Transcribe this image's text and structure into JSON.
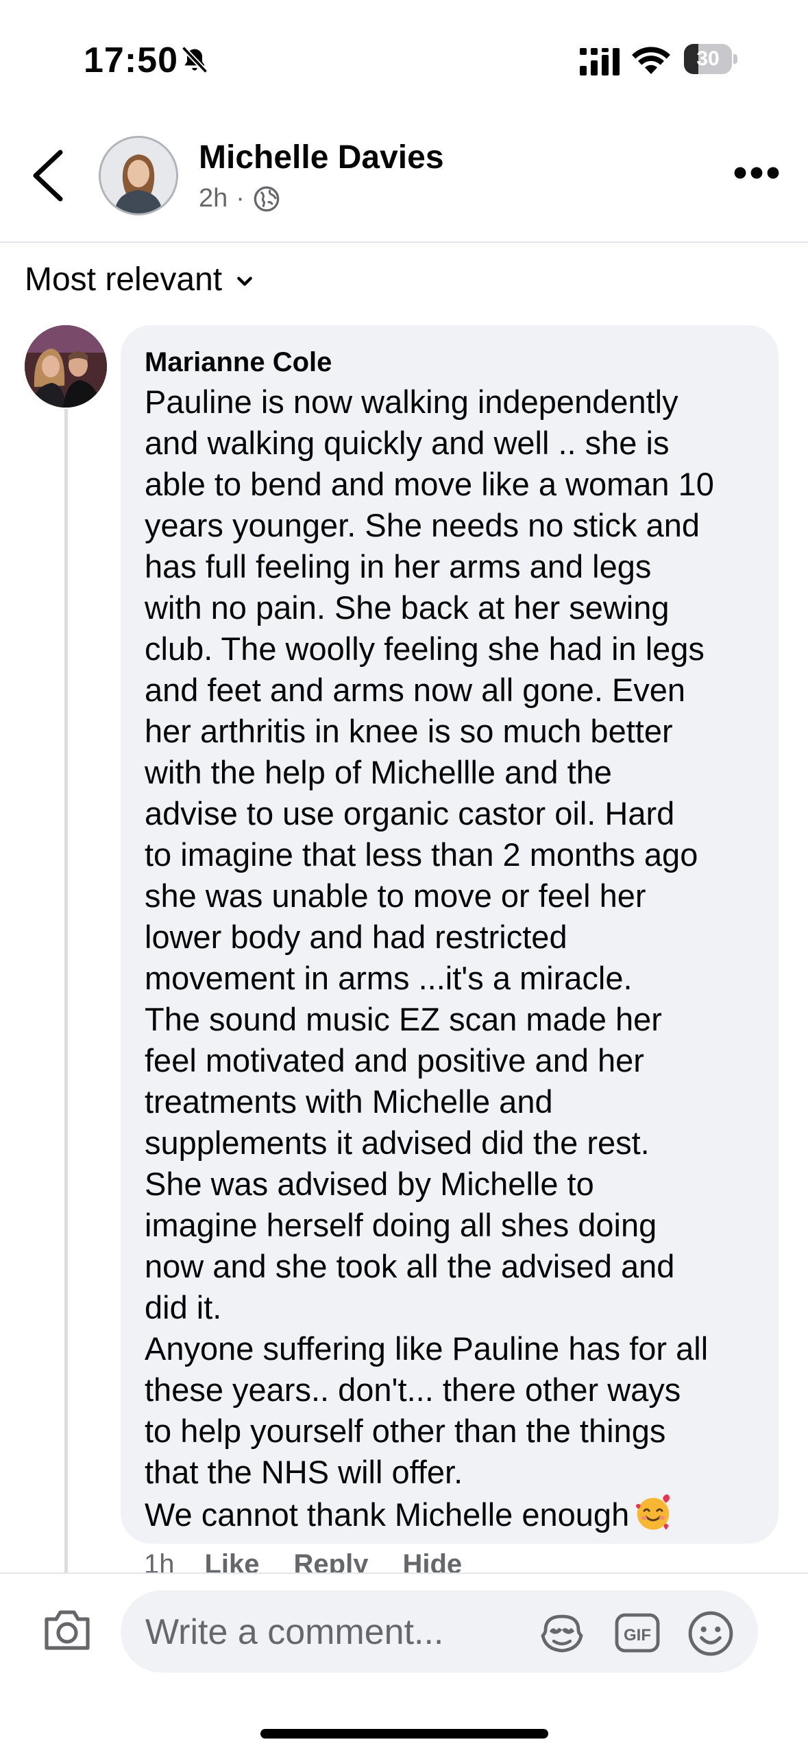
{
  "status_bar": {
    "time": "17:50",
    "battery": "30",
    "battery_level": 0.3,
    "icons": [
      "bell-slash-icon",
      "signal-icon",
      "wifi-icon",
      "battery-icon"
    ]
  },
  "header": {
    "name": "Michelle Davies",
    "age": "2h",
    "separator": "·",
    "audience_icon": "globe-icon",
    "back_icon": "chevron-left-icon",
    "more_icon": "more-horizontal-icon"
  },
  "sort": {
    "label": "Most relevant",
    "icon": "chevron-down-icon"
  },
  "comment": {
    "author": "Marianne Cole",
    "text": "Pauline is now walking independently\nand walking quickly and well .. she is\nable to bend and move like a woman 10\nyears younger. She needs no stick and\nhas full feeling in her arms and legs\nwith no pain. She back at her sewing\nclub. The woolly feeling she had in legs\nand feet and arms now all gone. Even\nher arthritis in knee is so much better\nwith the help of Michellle and the\nadvise to use organic castor oil. Hard\nto imagine that less than 2 months ago\nshe was unable to move or feel her\nlower body and had restricted\nmovement in arms ...it's a miracle.\nThe sound music EZ scan made her\nfeel motivated and positive and her\ntreatments with Michelle and\nsupplements it advised did the rest.\nShe was advised by Michelle to\nimagine herself doing all shes doing\nnow and she took all the advised and\ndid it.\nAnyone suffering like Pauline has for all\nthese years.. don't... there other ways\nto help yourself other than the things\nthat the NHS will offer.\nWe cannot thank Michelle enough",
    "emoji": "smiling-face-with-hearts",
    "age": "1h",
    "like": "Like",
    "reply": "Reply",
    "hide": "Hide"
  },
  "composer": {
    "placeholder": "Write a comment...",
    "gif_label": "GIF",
    "icons": [
      "camera-icon",
      "avatar-sticker-icon",
      "gif-icon",
      "emoji-icon"
    ]
  },
  "colors": {
    "secondary_text": "#65676b",
    "bubble": "#f0f2f5",
    "divider": "#e4e6eb"
  }
}
